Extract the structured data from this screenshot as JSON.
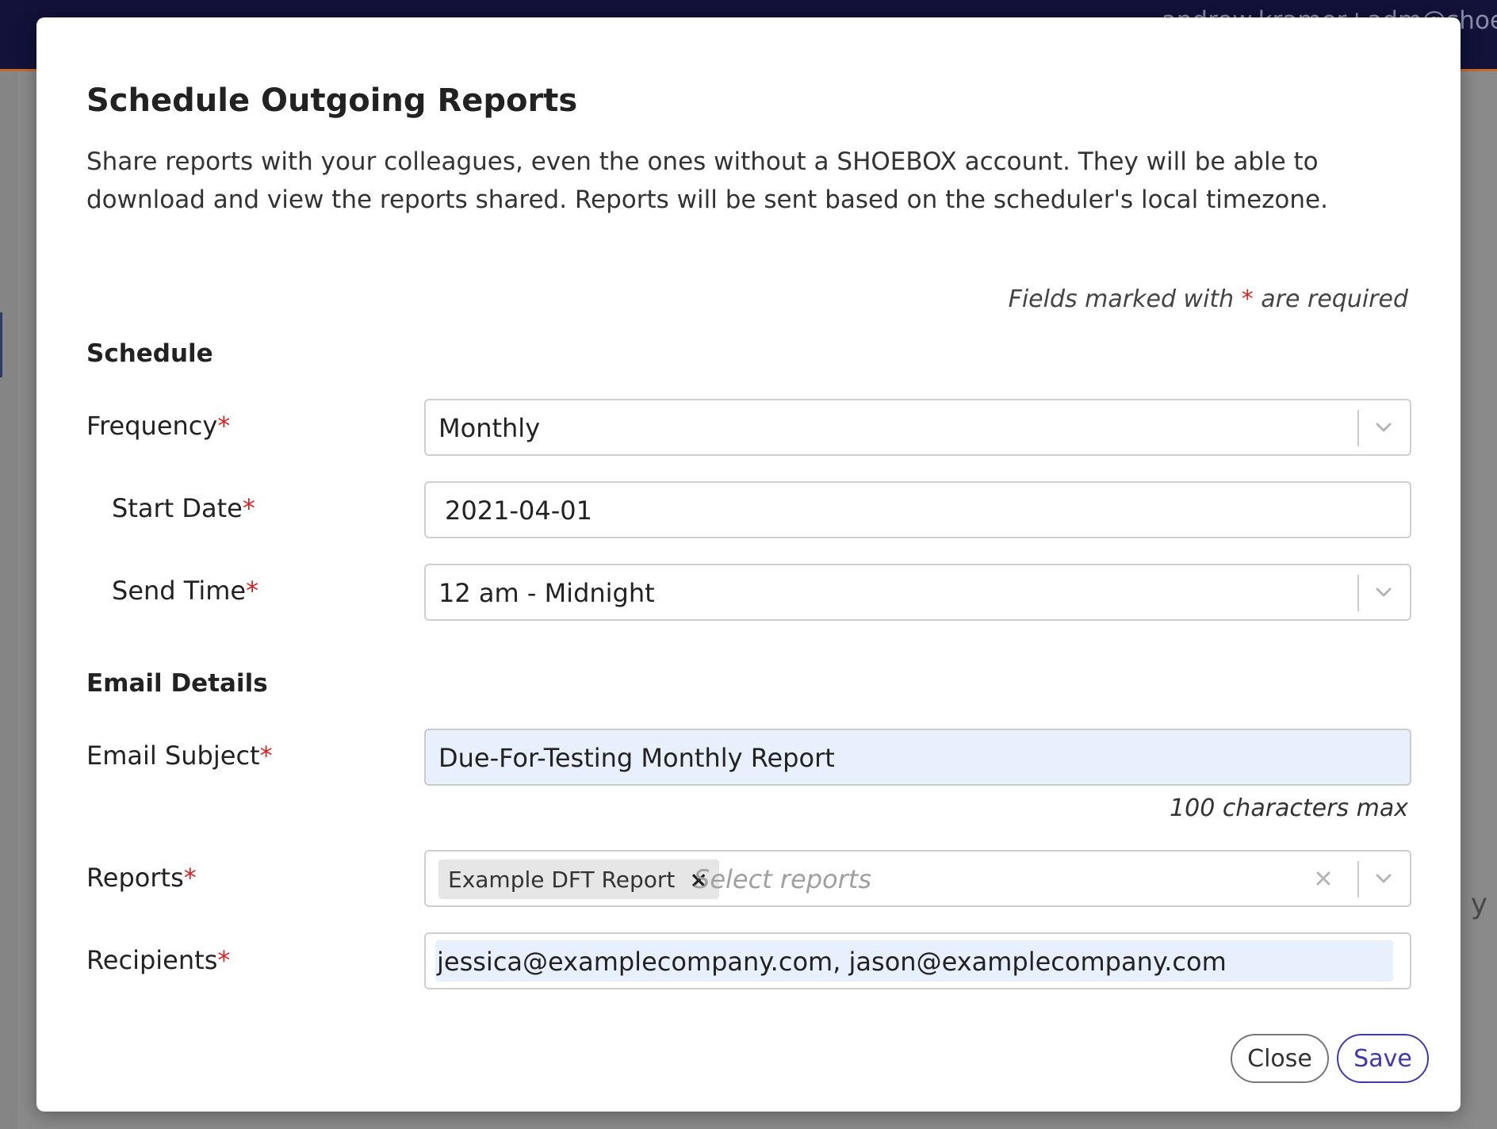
{
  "topbar": {
    "user_text": "andrew.kramer+adm@shoe"
  },
  "background": {
    "edge_text": "y"
  },
  "modal": {
    "title": "Schedule Outgoing Reports",
    "description": "Share reports with your colleagues, even the ones without a SHOEBOX account. They will be able to download and view the reports shared. Reports will be sent based on the scheduler's local timezone.",
    "required_note_prefix": "Fields marked with ",
    "required_note_star": "*",
    "required_note_suffix": " are required",
    "required_star": "*",
    "sections": {
      "schedule": "Schedule",
      "email_details": "Email Details"
    },
    "fields": {
      "frequency": {
        "label": "Frequency",
        "value": "Monthly"
      },
      "start_date": {
        "label": "Start Date",
        "value": "2021-04-01"
      },
      "send_time": {
        "label": "Send Time",
        "value": "12 am - Midnight"
      },
      "email_subject": {
        "label": "Email Subject",
        "value": "Due-For-Testing Monthly Report",
        "hint": "100 characters max"
      },
      "reports": {
        "label": "Reports",
        "selected": [
          "Example DFT Report"
        ],
        "chip_remove": "×",
        "placeholder": "Select reports"
      },
      "recipients": {
        "label": "Recipients",
        "value": "jessica@examplecompany.com, jason@examplecompany.com"
      }
    },
    "buttons": {
      "close": "Close",
      "save": "Save"
    }
  },
  "colors": {
    "accent": "#3f3aa8",
    "required": "#d32626",
    "autofill": "#e8f0fe",
    "topbar": "#12123a"
  }
}
